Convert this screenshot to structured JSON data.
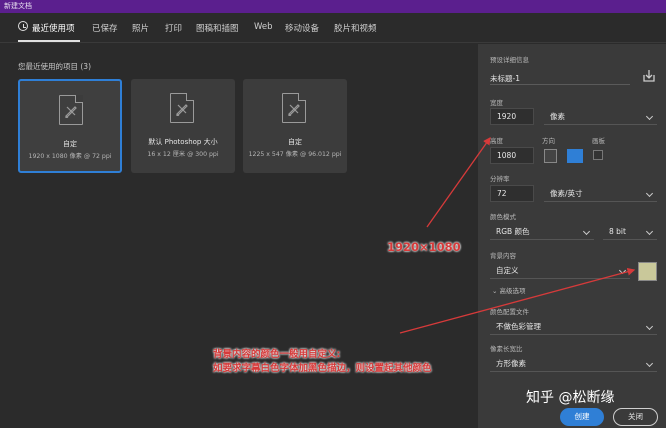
{
  "window": {
    "title": "新建文档"
  },
  "tabs": [
    "最近使用项",
    "已保存",
    "照片",
    "打印",
    "图稿和插图",
    "Web",
    "移动设备",
    "胶片和视频"
  ],
  "recent": {
    "title": "您最近使用的项目 (3)",
    "items": [
      {
        "name": "自定",
        "sub": "1920 x 1080 像素 @ 72 ppi"
      },
      {
        "name": "默认 Photoshop 大小",
        "sub": "16 x 12 厘米 @ 300 ppi"
      },
      {
        "name": "自定",
        "sub": "1225 x 547 像素 @ 96.012 ppi"
      }
    ]
  },
  "preset": {
    "section_label": "预设详细信息",
    "doc_name": "未标题-1",
    "width_label": "宽度",
    "width": "1920",
    "width_unit": "像素",
    "height_label": "高度",
    "height": "1080",
    "orientation_label": "方向",
    "artboard_label": "画板",
    "resolution_label": "分辨率",
    "resolution": "72",
    "resolution_unit": "像素/英寸",
    "color_mode_label": "颜色模式",
    "color_mode": "RGB 颜色",
    "bit_depth": "8 bit",
    "bg_label": "背景内容",
    "bg": "自定义",
    "bg_color": "#c9c89a",
    "advanced": "高级选项",
    "profile_label": "颜色配置文件",
    "profile": "不做色彩管理",
    "aspect_label": "像素长宽比",
    "aspect": "方形像素",
    "create": "创建",
    "close": "关闭"
  },
  "annotations": {
    "size_note": "1920×1080",
    "bg_note_1": "背景内容的颜色一般用自定义:",
    "bg_note_2": "如要求字幕白色字体加黑色描边，则设置起其他颜色",
    "arrow_color": "#d63a3a"
  },
  "watermark": "知乎 @松断缘"
}
